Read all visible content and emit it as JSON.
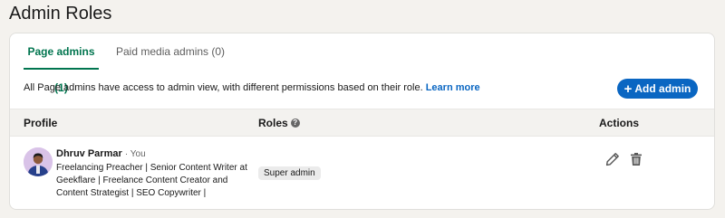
{
  "page_title": "Admin Roles",
  "tabs": [
    {
      "label": "Page admins (1)",
      "active": true
    },
    {
      "label": "Paid media admins (0)",
      "active": false
    }
  ],
  "info": {
    "text": "All Page admins have access to admin view, with different permissions based on their role.",
    "link": "Learn more"
  },
  "add_button": {
    "icon": "plus-icon",
    "label": "Add admin"
  },
  "table": {
    "headers": {
      "profile": "Profile",
      "roles": "Roles",
      "actions": "Actions"
    },
    "rows": [
      {
        "name": "Dhruv Parmar",
        "you_tag": "· You",
        "bio": "Freelancing Preacher | Senior Content Writer at Geekflare | Freelance Content Creator and Content Strategist | SEO Copywriter |",
        "role": "Super admin",
        "actions": [
          "pencil-icon",
          "trash-icon"
        ]
      }
    ]
  },
  "colors": {
    "accent_green": "#01754f",
    "brand_blue": "#0a66c2",
    "background": "#f4f2ee"
  }
}
